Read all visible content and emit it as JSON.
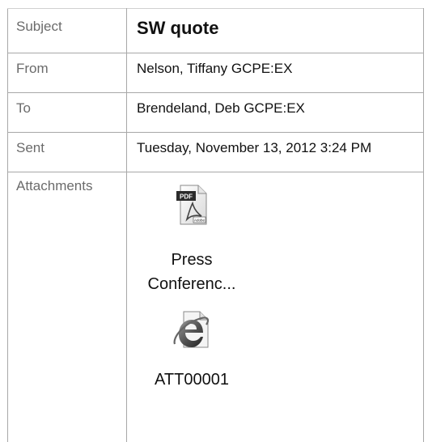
{
  "email": {
    "subject_label": "Subject",
    "subject": "SW quote",
    "from_label": "From",
    "from": "Nelson, Tiffany GCPE:EX",
    "to_label": "To",
    "to": "Brendeland, Deb GCPE:EX",
    "sent_label": "Sent",
    "sent": "Tuesday, November 13, 2012 3:24 PM",
    "attachments_label": "Attachments",
    "attachments": [
      {
        "icon": "pdf-file-icon",
        "name_line1": "Press",
        "name_line2": "Conferenc..."
      },
      {
        "icon": "internet-explorer-html-icon",
        "name_line1": "ATT00001"
      }
    ]
  }
}
